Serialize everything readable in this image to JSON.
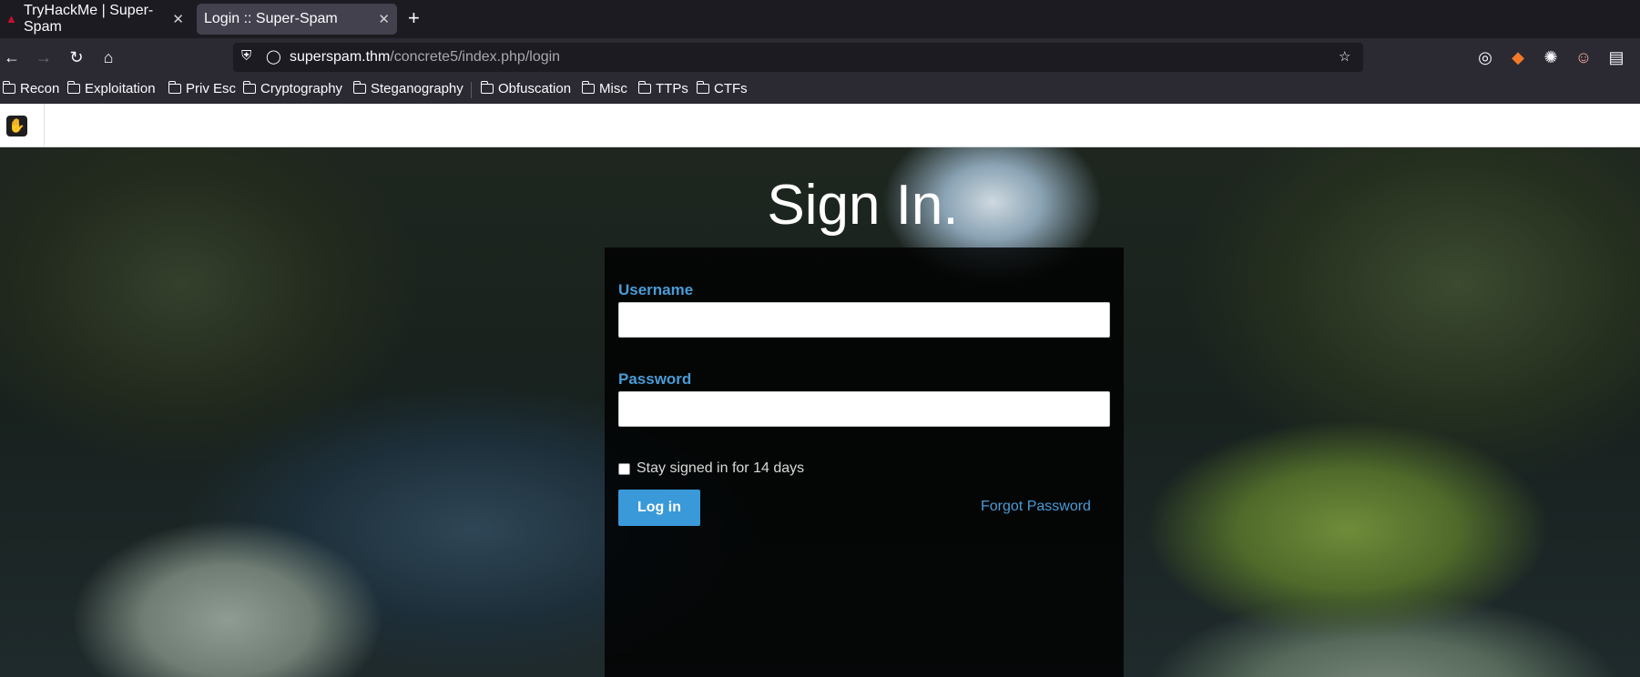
{
  "browser": {
    "tabs": [
      {
        "title": "TryHackMe | Super-Spam",
        "active": false
      },
      {
        "title": "Login :: Super-Spam",
        "active": true
      }
    ],
    "url": {
      "domain": "superspam.thm",
      "path": "/concrete5/index.php/login"
    },
    "bookmarks": [
      "Recon",
      "Exploitation",
      "Priv Esc",
      "Cryptography",
      "Steganography",
      "Obfuscation",
      "Misc",
      "TTPs",
      "CTFs"
    ]
  },
  "page": {
    "title": "Sign In.",
    "form": {
      "username_label": "Username",
      "username_value": "",
      "password_label": "Password",
      "password_value": "",
      "remember_label": "Stay signed in for 14 days",
      "remember_checked": false,
      "login_label": "Log in",
      "forgot_label": "Forgot Password"
    }
  },
  "colors": {
    "accent": "#3a99d8",
    "label": "#4a9bd6"
  }
}
